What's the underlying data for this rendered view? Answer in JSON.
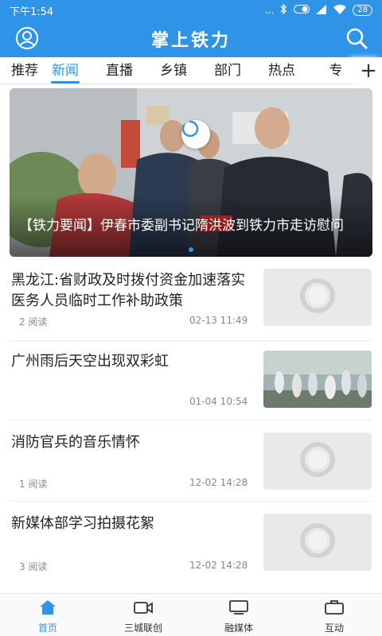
{
  "status_bar": {
    "time": "下午1:54",
    "signal_text": "...",
    "battery": "28"
  },
  "header": {
    "title": "掌上铁力",
    "profile_icon": "user-circle-icon",
    "search_icon": "search-icon"
  },
  "tabs": [
    {
      "label": "推荐"
    },
    {
      "label": "新闻",
      "active": true
    },
    {
      "label": "直播"
    },
    {
      "label": "乡镇"
    },
    {
      "label": "部门"
    },
    {
      "label": "热点"
    },
    {
      "label": "专"
    }
  ],
  "tabs_more": "+",
  "banner": {
    "caption": "【铁力要闻】伊春市委副书记隋洪波到铁力市走访慰问",
    "page_count": 3,
    "active_page": 1
  },
  "news": [
    {
      "title": "黑龙江:省财政及时拨付资金加速落实医务人员临时工作补助政策",
      "reads": "2 阅读",
      "date": "02-13 11:49",
      "thumb": "loading"
    },
    {
      "title": "广州雨后天空出现双彩虹",
      "reads": "",
      "date": "01-04 10:54",
      "thumb": "photo"
    },
    {
      "title": "消防官兵的音乐情怀",
      "reads": "1 阅读",
      "date": "12-02 14:28",
      "thumb": "loading"
    },
    {
      "title": "新媒体部学习拍摄花絮",
      "reads": "3 阅读",
      "date": "12-02 14:28",
      "thumb": "loading"
    }
  ],
  "bottom_nav": [
    {
      "label": "首页",
      "icon": "home-icon",
      "active": true
    },
    {
      "label": "三城联创",
      "icon": "video-camera-icon"
    },
    {
      "label": "融媒体",
      "icon": "monitor-icon"
    },
    {
      "label": "互动",
      "icon": "briefcase-icon"
    }
  ],
  "colors": {
    "brand": "#2f94e8",
    "text": "#222222",
    "muted": "#888888"
  }
}
